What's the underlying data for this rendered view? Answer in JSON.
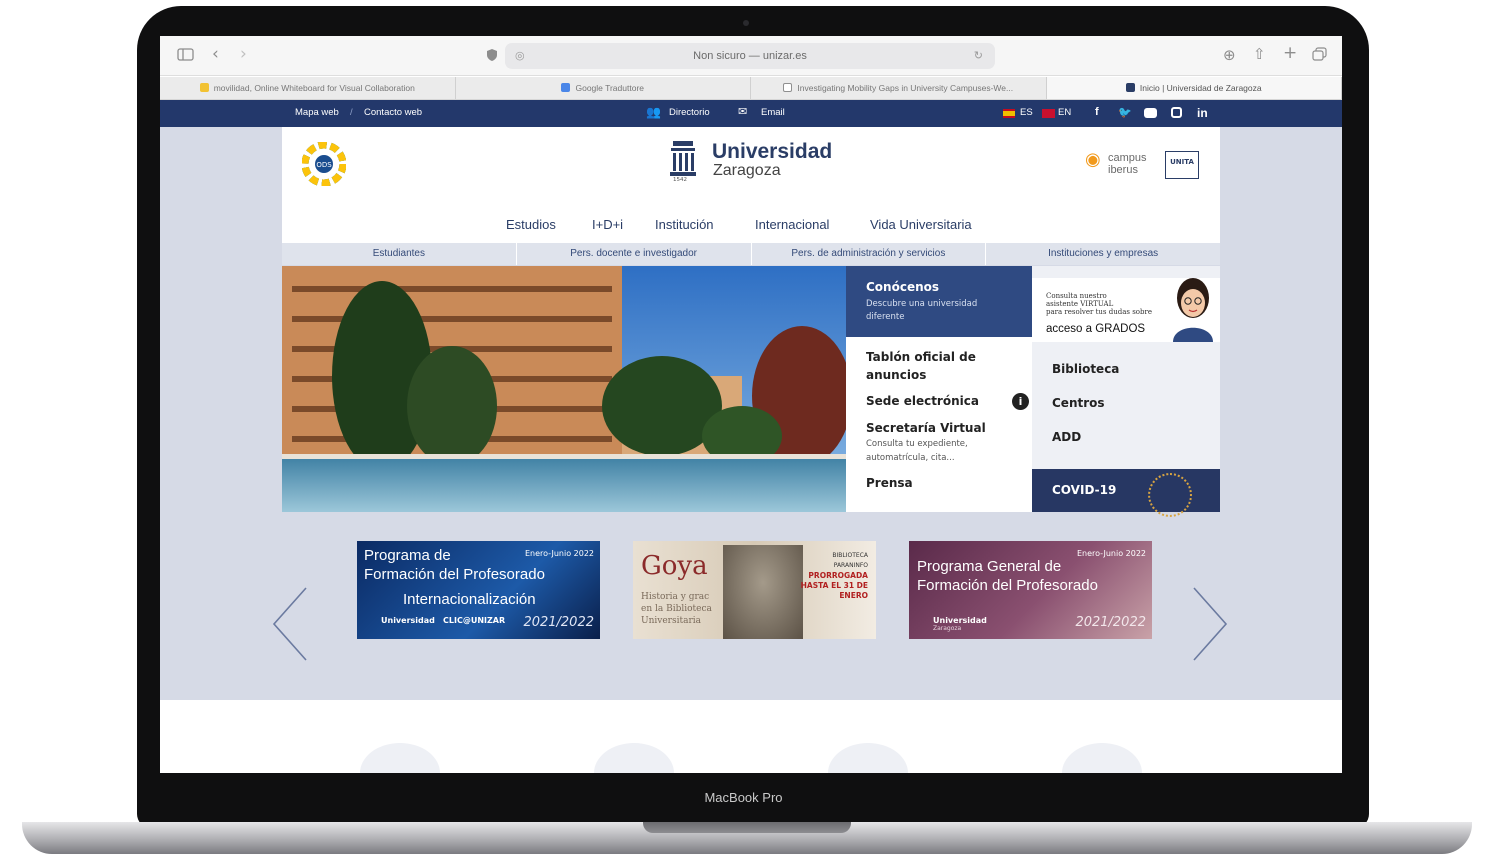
{
  "device": {
    "model_label": "MacBook Pro"
  },
  "browser": {
    "address_bar": "Non sicuro — unizar.es",
    "tabs": [
      {
        "label": "movilidad, Online Whiteboard for Visual Collaboration",
        "icon": "whiteboard-favicon",
        "color": "#f2c233"
      },
      {
        "label": "Google Traduttore",
        "icon": "translate-favicon",
        "color": "#4a86e8"
      },
      {
        "label": "Investigating Mobility Gaps in University Campuses-We...",
        "icon": "doc-favicon",
        "color": "#8f8f8f"
      },
      {
        "label": "Inicio | Universidad de Zaragoza",
        "icon": "unizar-favicon",
        "color": "#2a3d66"
      }
    ]
  },
  "site": {
    "topbar": {
      "sitemap": "Mapa web",
      "contact": "Contacto web",
      "directory": "Directorio",
      "email": "Email",
      "lang_es": "ES",
      "lang_en": "EN",
      "social": [
        "facebook-icon",
        "twitter-icon",
        "youtube-icon",
        "instagram-icon",
        "linkedin-icon"
      ]
    },
    "header": {
      "logo_line1": "Universidad",
      "logo_line2": "Zaragoza",
      "logo_year": "1542",
      "ods_label": "ODS",
      "campus_line1": "campus",
      "campus_line2": "iberus",
      "unita": "UNITA"
    },
    "main_nav": [
      "Estudios",
      "I+D+i",
      "Institución",
      "Internacional",
      "Vida Universitaria"
    ],
    "audience_nav": [
      "Estudiantes",
      "Pers. docente e investigador",
      "Pers. de administración y servicios",
      "Instituciones y empresas"
    ],
    "promo": {
      "title": "Conócenos",
      "subtitle_1": "Descubre una universidad",
      "subtitle_2": "diferente"
    },
    "quick_links": {
      "tablon_1": "Tablón oficial de",
      "tablon_2": "anuncios",
      "sede": "Sede electrónica",
      "secretaria": "Secretaría Virtual",
      "secretaria_sub_1": "Consulta tu expediente,",
      "secretaria_sub_2": "automatrícula, cita...",
      "prensa": "Prensa"
    },
    "assistant": {
      "line1": "Consulta nuestro",
      "line2": "asistente VIRTUAL",
      "line3": "para resolver tus dudas sobre",
      "line4": "acceso a GRADOS"
    },
    "side_links": [
      "Biblioteca",
      "Centros",
      "ADD"
    ],
    "covid": "COVID-19",
    "banners": [
      {
        "title_1": "Programa de",
        "title_2": "Formación del Profesorado",
        "tag": "Enero-Junio 2022",
        "sub": "Internacionalización",
        "footer": "2021/2022",
        "brand": "Universidad",
        "brand_2": "CLIC@UNIZAR"
      },
      {
        "title": "Goya",
        "sub_1": "Historia y grac",
        "sub_2": "en la Biblioteca",
        "sub_3": "Universitaria",
        "label_1": "BIBLIOTECA",
        "label_2": "PARANINFO",
        "label_3": "PRORROGADA",
        "label_4": "HASTA EL 31 DE",
        "label_5": "ENERO"
      },
      {
        "title_1": "Programa General de",
        "title_2": "Formación del Profesorado",
        "tag": "Enero-Junio 2022",
        "footer": "2021/2022",
        "brand": "Universidad",
        "brand_2": "Zaragoza"
      }
    ]
  }
}
